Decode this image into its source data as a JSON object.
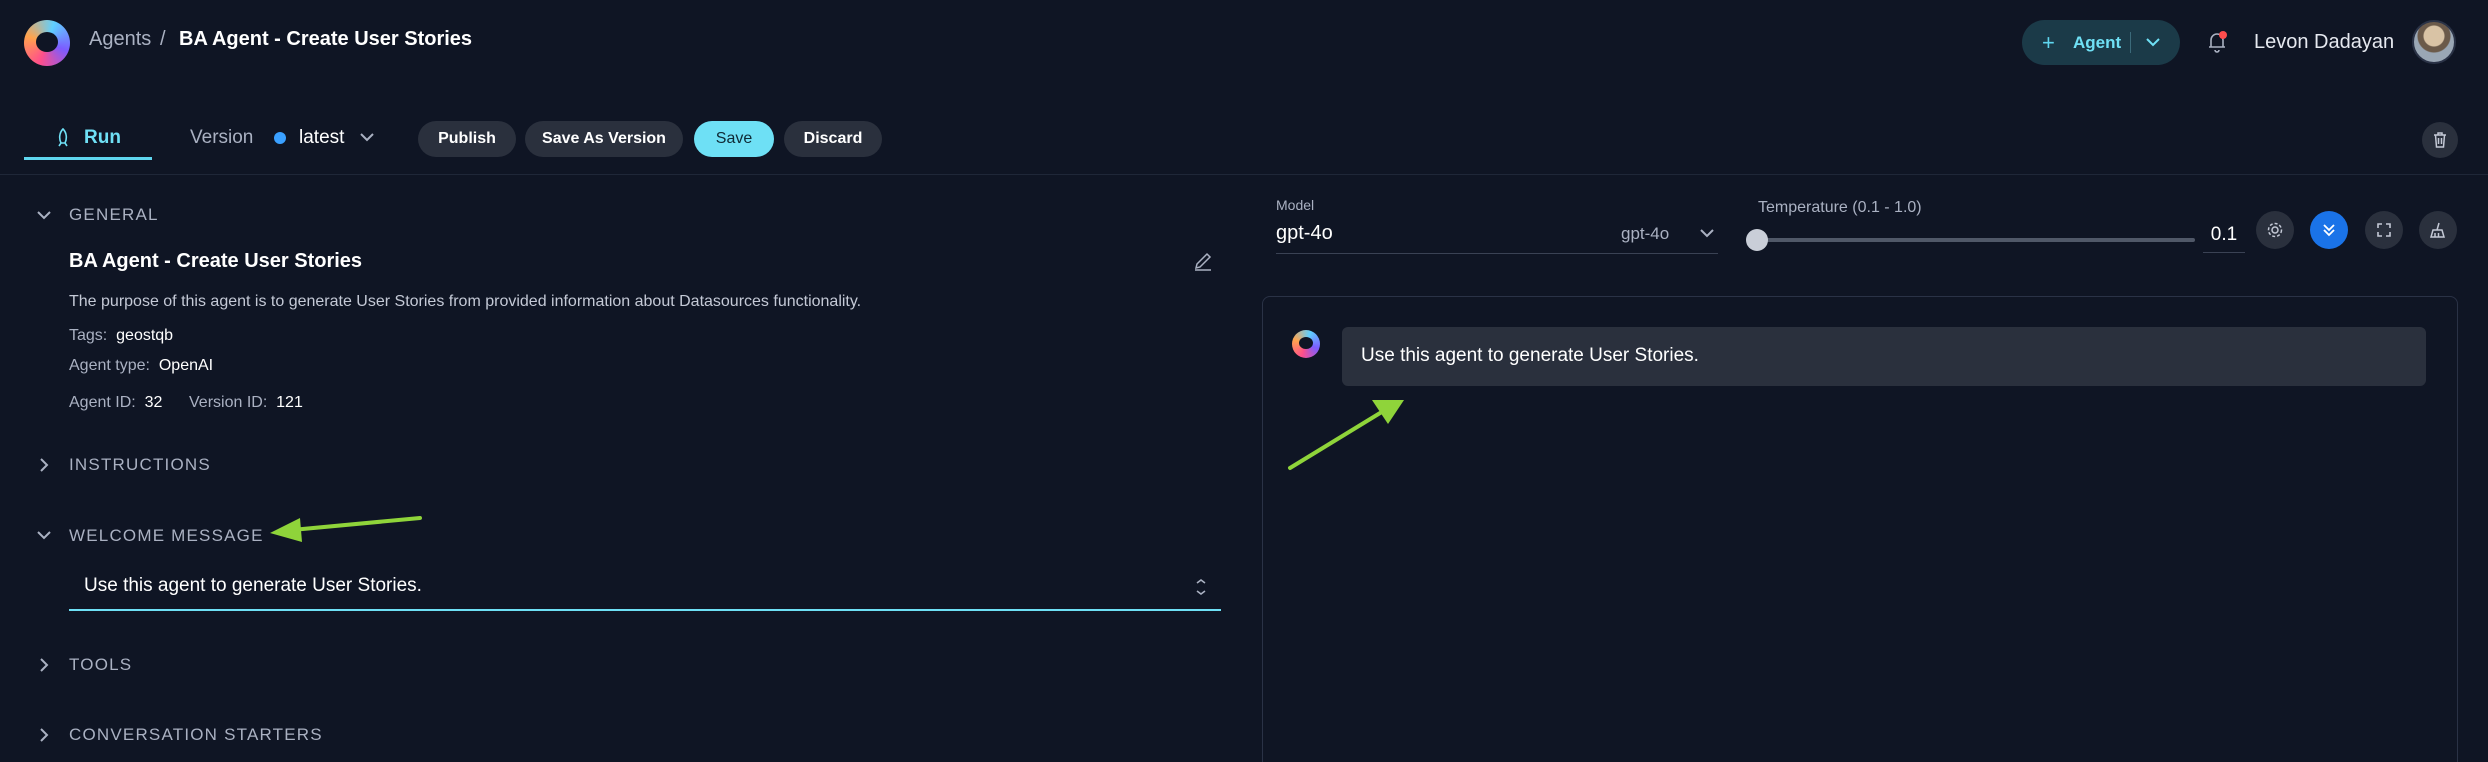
{
  "header": {
    "breadcrumb_root": "Agents",
    "breadcrumb_sep": "/",
    "breadcrumb_current": "BA Agent - Create User Stories",
    "agent_button_label": "Agent",
    "user_name": "Levon Dadayan"
  },
  "toolbar": {
    "run_tab": "Run",
    "version_label": "Version",
    "version_value": "latest",
    "publish": "Publish",
    "save_as_version": "Save As Version",
    "save": "Save",
    "discard": "Discard"
  },
  "general": {
    "section_title": "GENERAL",
    "agent_name": "BA Agent - Create User Stories",
    "description": "The purpose of this agent is to generate User Stories from provided information about Datasources functionality.",
    "tags_label": "Tags:",
    "tags_value": "geostqb",
    "type_label": "Agent type:",
    "type_value": "OpenAI",
    "agent_id_label": "Agent ID:",
    "agent_id_value": "32",
    "version_id_label": "Version ID:",
    "version_id_value": "121"
  },
  "sections": {
    "instructions": "INSTRUCTIONS",
    "welcome": "WELCOME MESSAGE",
    "welcome_text": "Use this agent to generate User Stories.",
    "tools": "TOOLS",
    "starters": "CONVERSATION STARTERS"
  },
  "model": {
    "label": "Model",
    "value": "gpt-4o",
    "selected": "gpt-4o",
    "temperature_label": "Temperature (0.1 - 1.0)",
    "temperature_value": "0.1"
  },
  "chat": {
    "welcome_message": "Use this agent to generate User Stories."
  },
  "colors": {
    "background": "#0f1524",
    "accent": "#6ee0f5",
    "annotation_arrow": "#8fd43a"
  }
}
